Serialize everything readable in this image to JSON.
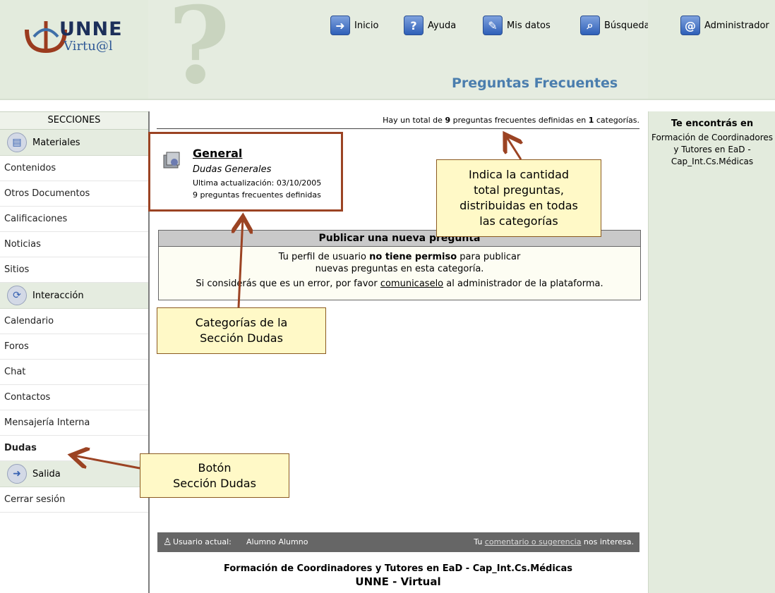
{
  "header": {
    "logo_main": "UNNE",
    "logo_sub": "Virtu@l",
    "page_title": "Preguntas Frecuentes",
    "nav": [
      {
        "label": "Inicio",
        "icon": "inicio-icon"
      },
      {
        "label": "Ayuda",
        "icon": "help-icon"
      },
      {
        "label": "Mis datos",
        "icon": "user-data-icon"
      },
      {
        "label": "Búsqueda",
        "icon": "search-icon"
      },
      {
        "label": "Administrador",
        "icon": "at-icon"
      }
    ]
  },
  "sidebar": {
    "heading": "SECCIONES",
    "materiales": "Materiales",
    "contenidos": "Contenidos",
    "otros": "Otros Documentos",
    "calificaciones": "Calificaciones",
    "noticias": "Noticias",
    "sitios": "Sitios",
    "interaccion": "Interacción",
    "calendario": "Calendario",
    "foros": "Foros",
    "chat": "Chat",
    "contactos": "Contactos",
    "mensajeria": "Mensajería Interna",
    "dudas": "Dudas",
    "salida": "Salida",
    "cerrar": "Cerrar sesión"
  },
  "location": {
    "title": "Te encontrás en",
    "text": "Formación de Coordinadores y Tutores en EaD - Cap_Int.Cs.Médicas"
  },
  "main": {
    "total_prefix": "Hay un total de ",
    "total_count": "9",
    "total_mid": " preguntas frecuentes definidas en ",
    "total_cats": "1",
    "total_suffix": " categorías.",
    "category": {
      "name": "General",
      "description": "Dudas Generales",
      "updated": "Ultima actualización: 03/10/2005",
      "count": "9 preguntas frecuentes definidas"
    },
    "publish": {
      "heading": "Publicar una nueva pregunta",
      "line1_a": "Tu perfil de usuario ",
      "line1_b": "no tiene permiso",
      "line1_c": " para publicar",
      "line2": "nuevas preguntas en esta categoría.",
      "line3_a": "Si considerás que es un error, por favor ",
      "line3_link": "comunicaselo",
      "line3_b": " al administrador de la plataforma."
    }
  },
  "callouts": {
    "total": [
      "Indica la cantidad",
      "total preguntas,",
      "distribuidas en todas",
      "las categorías"
    ],
    "categories": [
      "Categorías de la",
      "Sección Dudas"
    ],
    "button": [
      "Botón",
      "Sección Dudas"
    ]
  },
  "footer": {
    "user_label": "Usuario actual:",
    "user_name": "Alumno Alumno",
    "feedback_pre": "Tu ",
    "feedback_link": "comentario o sugerencia",
    "feedback_post": " nos interesa.",
    "course": "Formación de Coordinadores y Tutores en EaD - Cap_Int.Cs.Médicas",
    "brand": "UNNE - Virtual"
  },
  "colors": {
    "accent": "#4b7eae",
    "callout_border": "#9b4323",
    "callout_fill": "#fff9c7",
    "sidebar_bg": "#e5ece0"
  }
}
